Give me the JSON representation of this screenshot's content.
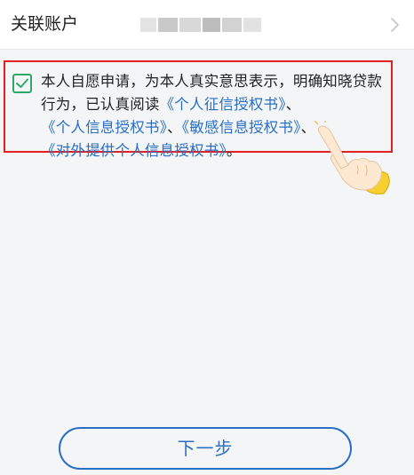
{
  "account": {
    "label": "关联账户"
  },
  "agreement": {
    "checked": true,
    "text_intro": "本人自愿申请，为本人真实意思表示，明确知晓贷款行为，已认真阅读",
    "sep1": "、",
    "sep2": "、",
    "sep3": "、",
    "ending": "。",
    "links": [
      "《个人征信授权书》",
      "《个人信息授权书》",
      "《敏感信息授权书》",
      "《对外提供个人信息授权书》"
    ]
  },
  "button": {
    "next_label": "下一步"
  },
  "colors": {
    "link": "#2a6fc4",
    "check": "#2fa66a",
    "highlight_border": "#e31f26",
    "button": "#2a6fc4"
  },
  "icons": {
    "check": "checkbox-checked-icon",
    "chevron": "chevron-right-icon",
    "hand": "pointing-hand-icon"
  }
}
